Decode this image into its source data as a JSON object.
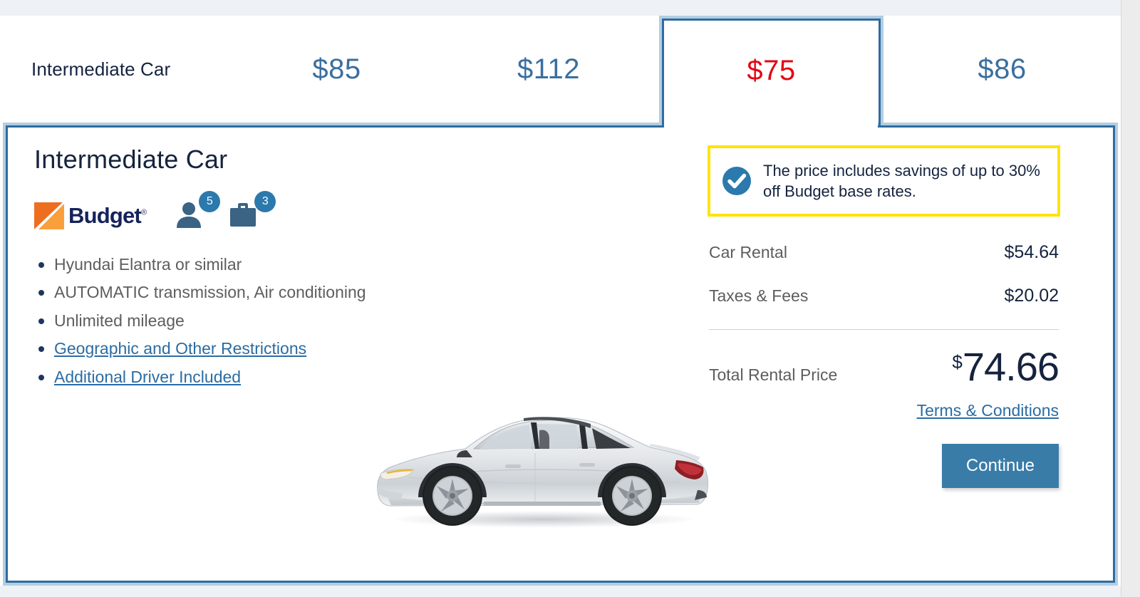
{
  "tabs": [
    {
      "label": "Intermediate Car",
      "price": "",
      "selected": false,
      "kind": "name"
    },
    {
      "label": "",
      "price": "$85",
      "selected": false,
      "kind": "price"
    },
    {
      "label": "",
      "price": "$112",
      "selected": false,
      "kind": "price"
    },
    {
      "label": "",
      "price": "$75",
      "selected": true,
      "kind": "price"
    },
    {
      "label": "",
      "price": "$86",
      "selected": false,
      "kind": "price"
    }
  ],
  "tab_row": {
    "category_label": "Intermediate Car",
    "price_1": "$85",
    "price_2": "$112",
    "price_3_selected": "$75",
    "price_4": "$86"
  },
  "detail": {
    "title": "Intermediate Car",
    "vendor": {
      "name": "Budget",
      "registered_mark": "®"
    },
    "capacity": {
      "passengers": "5",
      "luggage": "3"
    },
    "features": [
      {
        "text": "Hyundai Elantra or similar",
        "link": false
      },
      {
        "text": "AUTOMATIC transmission, Air conditioning",
        "link": false
      },
      {
        "text": "Unlimited mileage",
        "link": false
      },
      {
        "text": "Geographic and Other Restrictions",
        "link": true
      },
      {
        "text": "Additional Driver Included",
        "link": true
      }
    ],
    "car_image_alt": "Silver Hyundai Elantra sedan, side view"
  },
  "pricing": {
    "savings_note": "The price includes savings of up to 30% off Budget base rates.",
    "lines": [
      {
        "label": "Car Rental",
        "value": "$54.64"
      },
      {
        "label": "Taxes & Fees",
        "value": "$20.02"
      }
    ],
    "total_label": "Total Rental Price",
    "total_currency": "$",
    "total_amount": "74.66",
    "terms_link": "Terms & Conditions",
    "continue_label": "Continue"
  },
  "colors": {
    "accent_blue": "#2d6ca2",
    "tab_border_light": "#b4cde0",
    "selected_price_red": "#e30613",
    "unselected_price_blue": "#3a6f9f",
    "savings_border_yellow": "#ffe300",
    "button_blue": "#3a7ca8",
    "brand_navy": "#15235b",
    "brand_orange_dark": "#ed6e1e",
    "brand_orange_light": "#f9a03c",
    "link_blue": "#2b6ca3",
    "body_text_gray": "#5d5d5d"
  }
}
